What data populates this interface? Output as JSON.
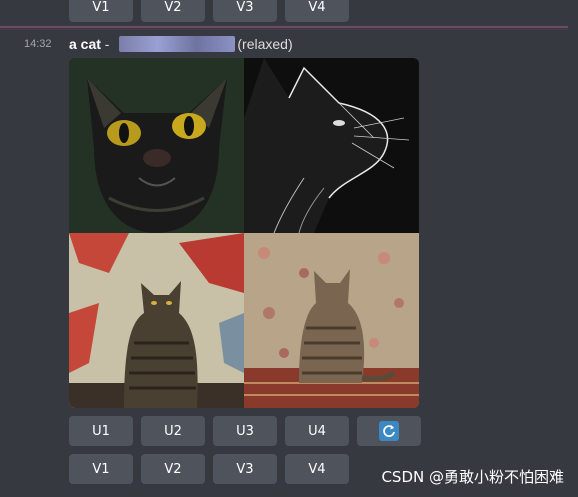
{
  "top_buttons": [
    "V1",
    "V2",
    "V3",
    "V4"
  ],
  "message": {
    "time": "14:32",
    "prompt": "a cat",
    "separator": " - ",
    "mode": "(relaxed)"
  },
  "image_grid": {
    "tiles": [
      "black-cat-close-up",
      "black-cat-profile-sketch",
      "tabby-cat-red-wall",
      "tabby-cat-floral-wallpaper"
    ]
  },
  "upscale_buttons": [
    "U1",
    "U2",
    "U3",
    "U4"
  ],
  "reroll_icon": "refresh-icon",
  "variation_buttons": [
    "V1",
    "V2",
    "V3",
    "V4"
  ],
  "watermark": "CSDN @勇敢小粉不怕困难"
}
